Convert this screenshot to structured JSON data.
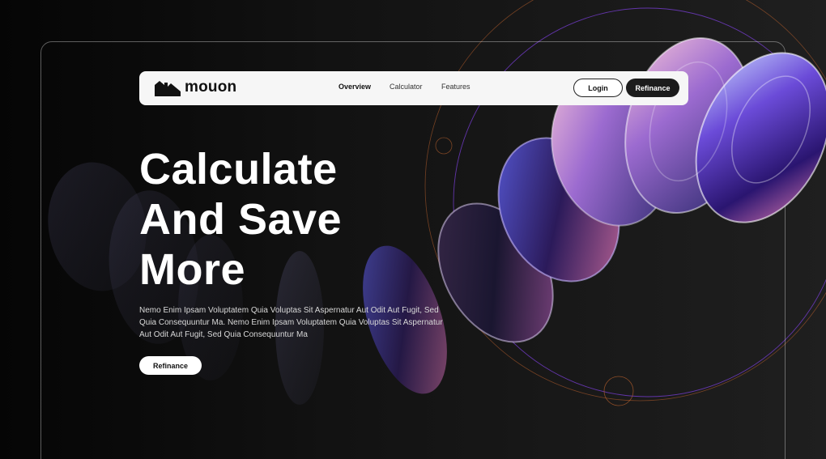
{
  "brand": {
    "name": "mouon",
    "icon": "house-logo-icon"
  },
  "nav": {
    "links": [
      "Overview",
      "Calculator",
      "Features"
    ],
    "login_label": "Login",
    "refinance_label": "Refinance"
  },
  "hero": {
    "title_lines": [
      "Calculate",
      "And Save",
      "More"
    ],
    "description": "Nemo Enim Ipsam Voluptatem Quia Voluptas Sit Aspernatur Aut Odit Aut Fugit, Sed Quia Consequuntur Ma. Nemo Enim Ipsam Voluptatem Quia Voluptas Sit Aspernatur Aut Odit Aut Fugit, Sed Quia Consequuntur Ma",
    "cta_label": "Refinance"
  },
  "colors": {
    "background": "#0b0b0c",
    "navbar": "#f6f6f6",
    "primary_button": "#1c1c1c",
    "accent_purple": "#7b3fd9",
    "accent_orange": "#c2652e"
  }
}
